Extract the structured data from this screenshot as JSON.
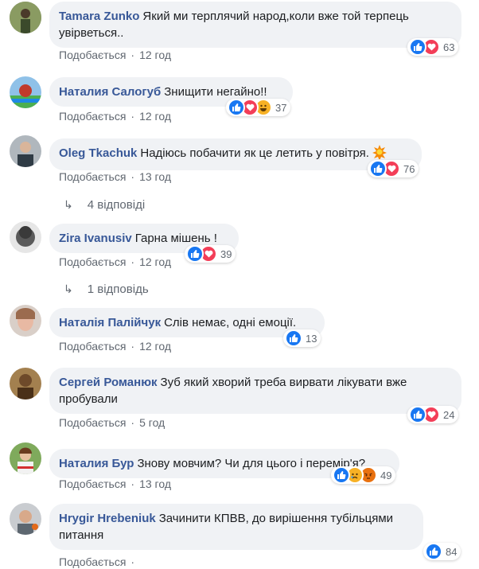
{
  "comments": [
    {
      "author": "Tamara Zunko",
      "text": "Який ми терплячий народ,коли вже той терпець увірветься..",
      "like": "Подобається",
      "time": "12 год",
      "count": "63"
    },
    {
      "author": "Наталия Салогуб",
      "text": "Знищити негайно!!",
      "like": "Подобається",
      "time": "12 год",
      "count": "37"
    },
    {
      "author": "Oleg Tkachuk",
      "text": "Надіюсь побачити як це летить у повітря.",
      "like": "Подобається",
      "time": "13 год",
      "count": "76",
      "replies": "4 відповіді"
    },
    {
      "author": "Zira Ivanusiv",
      "text": "Гарна мішень !",
      "like": "Подобається",
      "time": "12 год",
      "count": "39",
      "replies": "1 відповідь"
    },
    {
      "author": "Наталія Палійчук",
      "text": "Слів немає, одні емоції.",
      "like": "Подобається",
      "time": "12 год",
      "count": "13"
    },
    {
      "author": "Сергей Романюк",
      "text": "Зуб який хворий треба вирвати лікувати вже пробували",
      "like": "Подобається",
      "time": "5 год",
      "count": "24"
    },
    {
      "author": "Наталия Бур",
      "text": "Знову мовчим? Чи для цього і перемір'я?",
      "like": "Подобається",
      "time": "13 год",
      "count": "49"
    },
    {
      "author": "Hrygir Hrebeniuk",
      "text": "Зачинити КПВВ, до вирішення тубільцями питання",
      "like": "Подобається",
      "time": "",
      "count": "84"
    }
  ],
  "colors": {
    "author": "#385898",
    "bubble": "#f0f2f5",
    "like": "#1877f2",
    "love": "#f33e58",
    "haha": "#f7b125"
  },
  "icons": [
    "like-icon",
    "love-icon",
    "haha-icon",
    "sad-icon",
    "angry-icon",
    "reply-arrow-icon",
    "explosion-emoji-icon"
  ]
}
